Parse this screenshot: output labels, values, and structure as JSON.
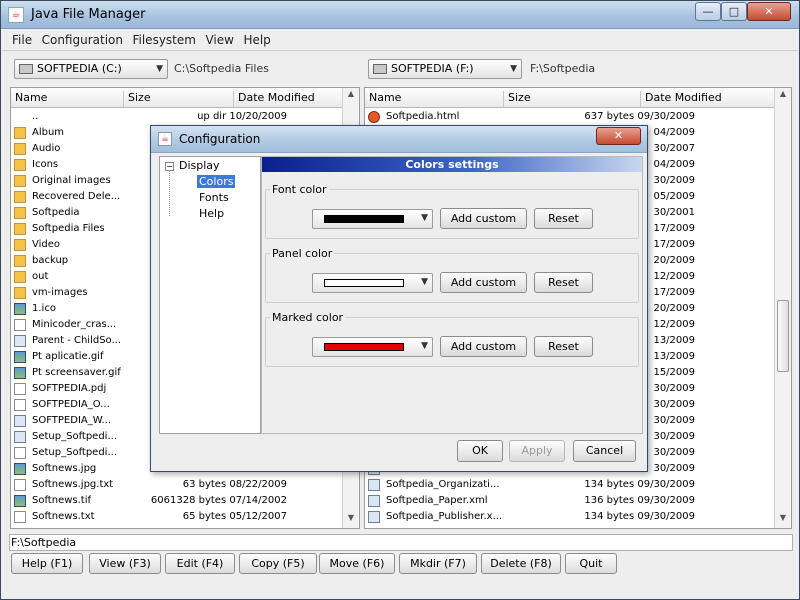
{
  "window": {
    "title": "Java File Manager",
    "min_label": "—",
    "max_label": "□",
    "close_label": "✕"
  },
  "menu": [
    "File",
    "Configuration",
    "Filesystem",
    "View",
    "Help"
  ],
  "left_pane": {
    "drive": "SOFTPEDIA (C:)",
    "path": "C:\\Softpedia Files",
    "columns": [
      "Name",
      "Size",
      "Date Modified"
    ],
    "rows": [
      {
        "icon": "up",
        "name": "..",
        "meta": "up dir 10/20/2009"
      },
      {
        "icon": "folder",
        "name": "Album",
        "meta": ""
      },
      {
        "icon": "folder",
        "name": "Audio",
        "meta": ""
      },
      {
        "icon": "folder",
        "name": "Icons",
        "meta": ""
      },
      {
        "icon": "folder",
        "name": "Original images",
        "meta": ""
      },
      {
        "icon": "folder",
        "name": "Recovered Dele...",
        "meta": ""
      },
      {
        "icon": "folder",
        "name": "Softpedia",
        "meta": ""
      },
      {
        "icon": "folder",
        "name": "Softpedia Files",
        "meta": ""
      },
      {
        "icon": "folder",
        "name": "Video",
        "meta": ""
      },
      {
        "icon": "folder",
        "name": "backup",
        "meta": ""
      },
      {
        "icon": "folder",
        "name": "out",
        "meta": ""
      },
      {
        "icon": "folder",
        "name": "vm-images",
        "meta": ""
      },
      {
        "icon": "img",
        "name": "1.ico",
        "meta": ""
      },
      {
        "icon": "file",
        "name": "Minicoder_cras...",
        "meta": ""
      },
      {
        "icon": "cfg",
        "name": "Parent - ChildSo...",
        "meta": ""
      },
      {
        "icon": "img",
        "name": "Pt aplicatie.gif",
        "meta": ""
      },
      {
        "icon": "img",
        "name": "Pt screensaver.gif",
        "meta": ""
      },
      {
        "icon": "file",
        "name": "SOFTPEDIA.pdj",
        "meta": ""
      },
      {
        "icon": "file",
        "name": "SOFTPEDIA_O...",
        "meta": ""
      },
      {
        "icon": "cfg",
        "name": "SOFTPEDIA_W...",
        "meta": ""
      },
      {
        "icon": "cfg",
        "name": "Setup_Softpedi...",
        "meta": ""
      },
      {
        "icon": "file",
        "name": "Setup_Softpedi...",
        "meta": ""
      },
      {
        "icon": "img",
        "name": "Softnews.jpg",
        "meta": ""
      },
      {
        "icon": "file",
        "name": "Softnews.jpg.txt",
        "meta": "63 bytes 08/22/2009"
      },
      {
        "icon": "img",
        "name": "Softnews.tif",
        "meta": "6061328 bytes 07/14/2002"
      },
      {
        "icon": "file",
        "name": "Softnews.txt",
        "meta": "65 bytes 05/12/2007"
      }
    ]
  },
  "right_pane": {
    "drive": "SOFTPEDIA (F:)",
    "path": "F:\\Softpedia",
    "columns": [
      "Name",
      "Size",
      "Date Modified"
    ],
    "rows": [
      {
        "icon": "html",
        "name": "Softpedia.html",
        "meta": "637 bytes 09/30/2009"
      },
      {
        "icon": "cfg",
        "name": "",
        "meta": "04/2009"
      },
      {
        "icon": "cfg",
        "name": "",
        "meta": "30/2007"
      },
      {
        "icon": "cfg",
        "name": "",
        "meta": "04/2009"
      },
      {
        "icon": "cfg",
        "name": "",
        "meta": "30/2009"
      },
      {
        "icon": "cfg",
        "name": "",
        "meta": "05/2009"
      },
      {
        "icon": "cfg",
        "name": "",
        "meta": "30/2001"
      },
      {
        "icon": "cfg",
        "name": "",
        "meta": "17/2009"
      },
      {
        "icon": "cfg",
        "name": "",
        "meta": "17/2009"
      },
      {
        "icon": "cfg",
        "name": "",
        "meta": "20/2009"
      },
      {
        "icon": "cfg",
        "name": "",
        "meta": "12/2009"
      },
      {
        "icon": "cfg",
        "name": "",
        "meta": "17/2009"
      },
      {
        "icon": "cfg",
        "name": "",
        "meta": "20/2009"
      },
      {
        "icon": "cfg",
        "name": "",
        "meta": "12/2009"
      },
      {
        "icon": "cfg",
        "name": "",
        "meta": "13/2009"
      },
      {
        "icon": "cfg",
        "name": "",
        "meta": "13/2009"
      },
      {
        "icon": "cfg",
        "name": "",
        "meta": "15/2009"
      },
      {
        "icon": "cfg",
        "name": "",
        "meta": "30/2009"
      },
      {
        "icon": "cfg",
        "name": "",
        "meta": "30/2009"
      },
      {
        "icon": "cfg",
        "name": "",
        "meta": "30/2009"
      },
      {
        "icon": "cfg",
        "name": "",
        "meta": "30/2009"
      },
      {
        "icon": "cfg",
        "name": "",
        "meta": "30/2009"
      },
      {
        "icon": "cfg",
        "name": "",
        "meta": "30/2009"
      },
      {
        "icon": "cfg",
        "name": "Softpedia_Organizati...",
        "meta": "134 bytes 09/30/2009"
      },
      {
        "icon": "cfg",
        "name": "Softpedia_Paper.xml",
        "meta": "136 bytes 09/30/2009"
      },
      {
        "icon": "cfg",
        "name": "Softpedia_Publisher.x...",
        "meta": "134 bytes 09/30/2009"
      }
    ]
  },
  "command_line": "F:\\Softpedia",
  "function_keys": [
    "Help (F1)",
    "View (F3)",
    "Edit (F4)",
    "Copy (F5)",
    "Move (F6)",
    "Mkdir (F7)",
    "Delete (F8)",
    "Quit"
  ],
  "dialog": {
    "title": "Configuration",
    "close_label": "✕",
    "tree": {
      "root": "Display",
      "items": [
        "Colors",
        "Fonts",
        "Help"
      ],
      "selected": "Colors"
    },
    "header": "Colors settings",
    "groups": [
      {
        "label": "Font color",
        "color": "#000000",
        "add": "Add custom",
        "reset": "Reset"
      },
      {
        "label": "Panel color",
        "color": "#ffffff",
        "add": "Add custom",
        "reset": "Reset"
      },
      {
        "label": "Marked color",
        "color": "#e00000",
        "add": "Add custom",
        "reset": "Reset"
      }
    ],
    "buttons": {
      "ok": "OK",
      "apply": "Apply",
      "cancel": "Cancel"
    }
  }
}
